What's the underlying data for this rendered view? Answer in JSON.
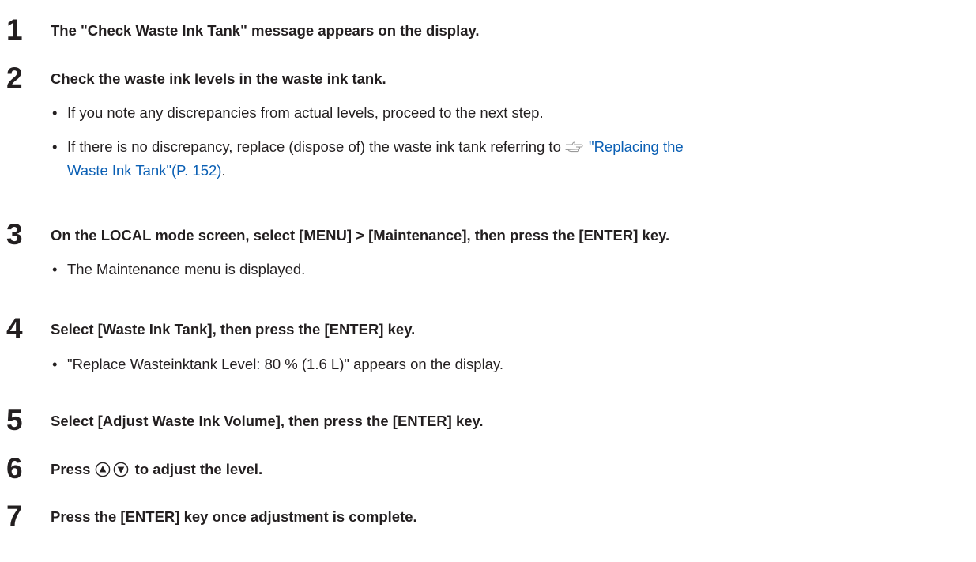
{
  "steps": [
    {
      "number": "1",
      "text": "The \"Check Waste Ink Tank\" message appears on the display."
    },
    {
      "number": "2",
      "text": "Check the waste ink levels in the waste ink tank.",
      "bullets": [
        {
          "text": "If you note any discrepancies from actual levels, proceed to the next step."
        },
        {
          "text_before": "If there is no discrepancy, replace (dispose of) the waste ink tank referring to ",
          "link_line1": "\"Replacing the",
          "link_line2": "Waste Ink Tank\"(P. 152)",
          "text_after": "."
        }
      ]
    },
    {
      "number": "3",
      "text": "On the LOCAL mode screen, select [MENU] > [Maintenance], then press the [ENTER] key.",
      "bullets": [
        {
          "text": "The Maintenance menu is displayed."
        }
      ]
    },
    {
      "number": "4",
      "text": "Select [Waste Ink Tank], then press the [ENTER] key.",
      "bullets": [
        {
          "text": "\"Replace Wasteinktank Level: 80 % (1.6 L)\" appears on the display."
        }
      ]
    },
    {
      "number": "5",
      "text": "Select [Adjust Waste Ink Volume], then press the [ENTER] key."
    },
    {
      "number": "6",
      "text_before": "Press ",
      "text_after": " to adjust the level."
    },
    {
      "number": "7",
      "text": "Press the [ENTER] key once adjustment is complete."
    }
  ],
  "bullet_char": "•",
  "icons": {
    "reference": "pointing-hand-icon",
    "up_key": "up-arrow-key-icon",
    "down_key": "down-arrow-key-icon"
  },
  "colors": {
    "text": "#231f20",
    "link": "#0a5fb4"
  }
}
